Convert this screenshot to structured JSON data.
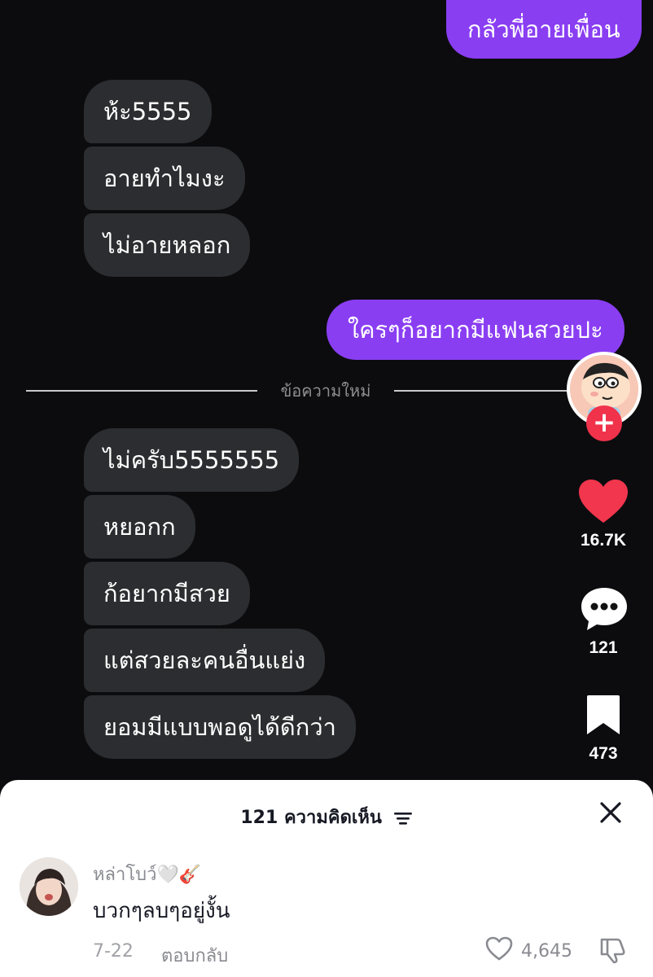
{
  "messages": {
    "out_1": "กลัวพี่อายเพื่อน",
    "in_group_1": [
      "ห้ะ5555",
      "อายทำไมงะ",
      "ไม่อายหลอก"
    ],
    "out_2": "ใครๆก็อยากมีแฟนสวยปะ",
    "divider": "ข้อความใหม่",
    "in_group_2": [
      "ไม่ครับ5555555",
      "หยอกก",
      "ก้อยากมีสวย",
      "แต่สวยละคนอื่นแย่ง",
      "ยอมมีแบบพอดูได้ดีกว่า"
    ]
  },
  "rail": {
    "likes": "16.7K",
    "comments": "121",
    "saves": "473"
  },
  "comments_sheet": {
    "title": "121 ความคิดเห็น",
    "comment": {
      "username": "หล่าโบว์🤍🎸",
      "text": "บวกๆลบๆอยู่งั้น",
      "date": "7-22",
      "reply_label": "ตอบกลับ",
      "like_count": "4,645"
    }
  },
  "colors": {
    "outgoing_bubble": "#8a3ef2",
    "incoming_bubble": "#2c2d30",
    "like_heart": "#f2364d",
    "follow_plus": "#f0324b",
    "background": "#0c0c0f"
  },
  "icons": [
    "heart-icon",
    "comment-icon",
    "bookmark-icon",
    "plus-icon",
    "filter-icon",
    "close-icon",
    "like-outline-icon",
    "dislike-icon"
  ]
}
